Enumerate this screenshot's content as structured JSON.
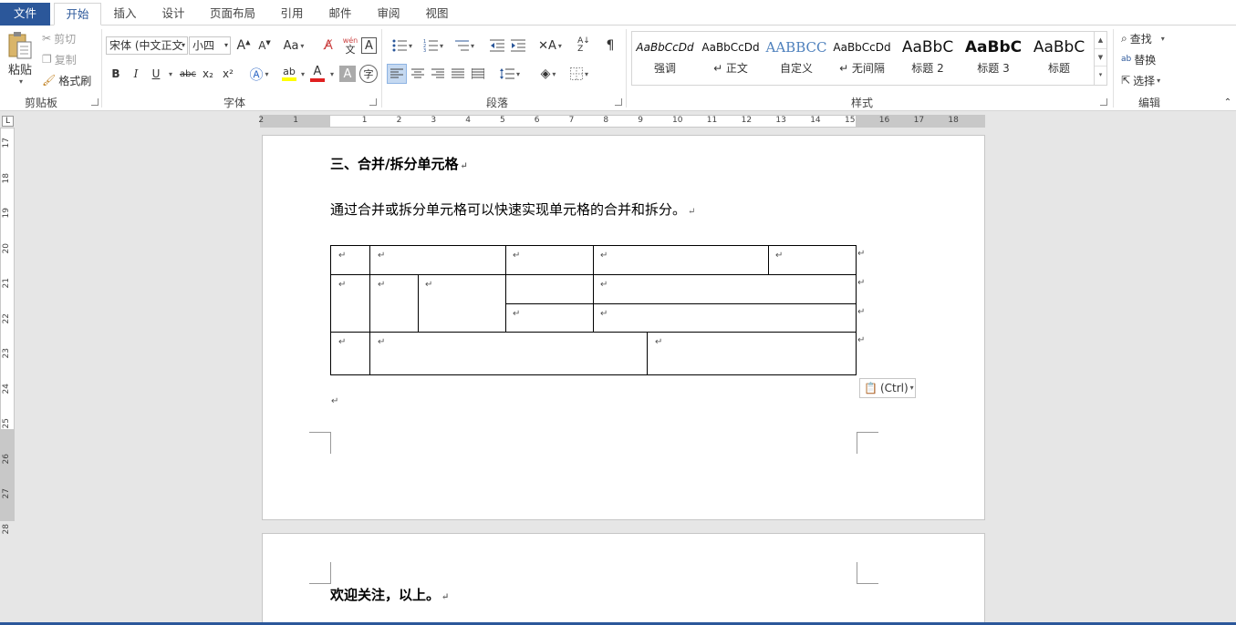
{
  "tabs": [
    {
      "label": "文件",
      "type": "file"
    },
    {
      "label": "开始",
      "type": "active"
    },
    {
      "label": "插入"
    },
    {
      "label": "设计"
    },
    {
      "label": "页面布局"
    },
    {
      "label": "引用"
    },
    {
      "label": "邮件"
    },
    {
      "label": "审阅"
    },
    {
      "label": "视图"
    }
  ],
  "clipboard": {
    "paste_label": "粘贴",
    "cut_label": "剪切",
    "copy_label": "复制",
    "format_painter_label": "格式刷",
    "group_label": "剪贴板"
  },
  "font": {
    "font_name": "宋体 (中文正文",
    "font_size": "小四",
    "group_label": "字体",
    "case_label": "Aa",
    "phonetic_top": "wén",
    "phonetic_bottom": "文",
    "bold_label": "B",
    "italic_label": "I",
    "underline_label": "U",
    "strike_label": "abc",
    "subscript_label": "x₂",
    "superscript_label": "x²",
    "highlight_color": "#ffff00",
    "font_color": "#e02020"
  },
  "paragraph": {
    "group_label": "段落"
  },
  "styles": {
    "group_label": "样式",
    "items": [
      {
        "preview": "AaBbCcDd",
        "name": "强调"
      },
      {
        "preview": "AaBbCcDd",
        "name": "↵ 正文"
      },
      {
        "preview": "AABBCC",
        "name": "自定义"
      },
      {
        "preview": "AaBbCcDd",
        "name": "↵ 无间隔"
      },
      {
        "preview": "AaBbC",
        "name": "标题 2"
      },
      {
        "preview": "AaBbC",
        "name": "标题 3"
      },
      {
        "preview": "AaBbC",
        "name": "标题"
      }
    ]
  },
  "editing": {
    "group_label": "编辑",
    "find_label": "查找",
    "replace_label": "替换",
    "select_label": "选择"
  },
  "ruler": {
    "h_numbers": [
      "2",
      "1",
      "1",
      "2",
      "3",
      "4",
      "5",
      "6",
      "7",
      "8",
      "9",
      "10",
      "11",
      "12",
      "13",
      "14",
      "15",
      "16",
      "17",
      "18"
    ],
    "v_numbers": [
      "17",
      "18",
      "19",
      "20",
      "21",
      "22",
      "23",
      "24",
      "25",
      "26",
      "27",
      "28"
    ],
    "corner_label": "L"
  },
  "document": {
    "heading": "三、合并/拆分单元格",
    "body": "通过合并或拆分单元格可以快速实现单元格的合并和拆分。",
    "para_mark": "↵",
    "page2_text": "欢迎关注，以上。"
  },
  "paste_options": {
    "label": "(Ctrl)"
  },
  "colors": {
    "accent": "#2b579a"
  }
}
